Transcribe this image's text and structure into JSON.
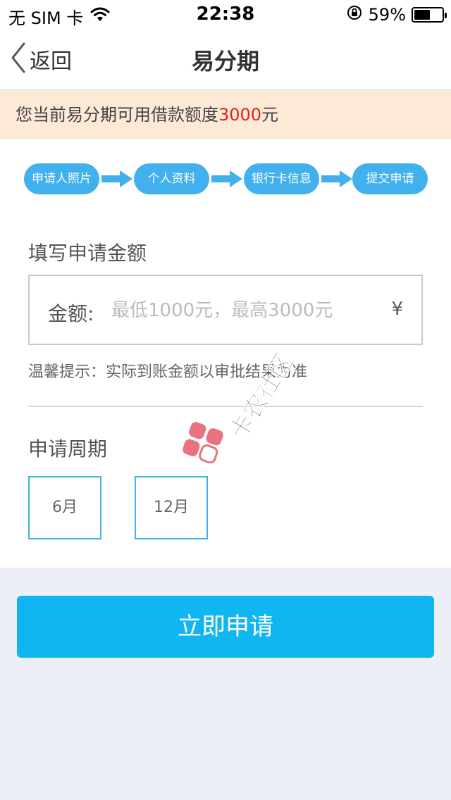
{
  "status_bar": {
    "carrier": "无 SIM 卡",
    "time": "22:38",
    "battery_percent": "59%",
    "battery_level": 0.59
  },
  "nav": {
    "back_label": "返回",
    "title": "易分期"
  },
  "banner": {
    "prefix": "您当前易分期可用借款额度",
    "amount": "3000",
    "suffix": "元"
  },
  "steps": [
    "申请人照片",
    "个人资料",
    "银行卡信息",
    "提交申请"
  ],
  "amount_section": {
    "label": "填写申请金额",
    "field_label": "金额:",
    "placeholder": "最低1000元，最高3000元",
    "value": "",
    "currency_symbol": "¥"
  },
  "tip": "温馨提示：实际到账金额以审批结果为准",
  "period_section": {
    "label": "申请周期",
    "options": [
      "6月",
      "12月"
    ]
  },
  "submit_label": "立即申请",
  "watermark": {
    "text": "卡农社区"
  },
  "colors": {
    "accent": "#41b0ec",
    "button": "#0fb6f1",
    "banner_bg": "#fce9d6",
    "highlight": "#e0231b",
    "page_bg": "#eceff5"
  }
}
